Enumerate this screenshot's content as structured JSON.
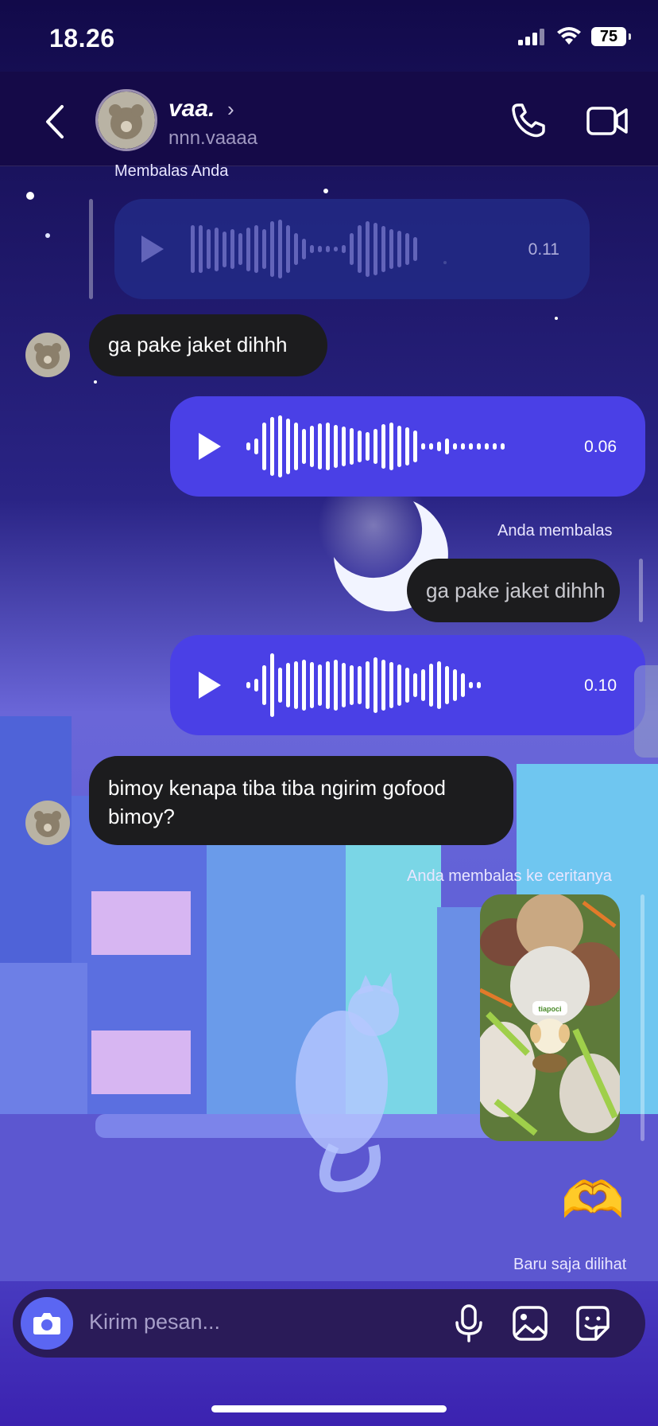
{
  "status": {
    "time": "18.26",
    "battery": "75"
  },
  "header": {
    "name": "vaa.",
    "username": "nnn.vaaaa"
  },
  "messages": {
    "reply_label_1": "Membalas Anda",
    "voice_1_duration": "0.11",
    "text_1": "ga pake jaket dihhh",
    "voice_2_duration": "0.06",
    "reply_label_2": "Anda membalas",
    "text_2": "ga pake jaket dihhh",
    "voice_3_duration": "0.10",
    "text_3_line1": "bimoy kenapa tiba tiba ngirim gofood",
    "text_3_line2": "bimoy?",
    "story_reply_label": "Anda membalas ke ceritanya",
    "sticker_text": "tiapoci",
    "reaction_emoji": "🫶",
    "seen": "Baru saja dilihat"
  },
  "input": {
    "placeholder": "Kirim pesan..."
  },
  "colors": {
    "voice_bubble": "#4a40e6",
    "dark_bubble": "#1c1c1e",
    "camera_button": "#5b66f2"
  }
}
